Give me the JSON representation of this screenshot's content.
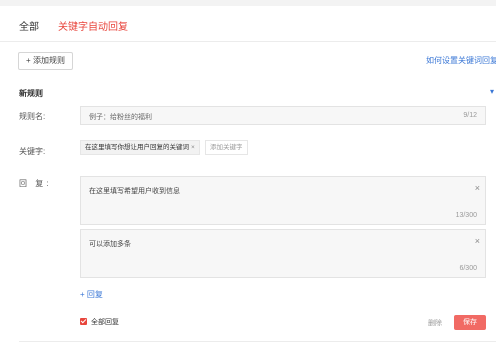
{
  "tabs": [
    {
      "label": "全部"
    },
    {
      "label": "关键字自动回复"
    }
  ],
  "toolbar": {
    "add_rule_label": "+ 添加规则",
    "help_link": "如何设置关键词回复"
  },
  "rule": {
    "section_title": "新规则",
    "name_label": "规则名:",
    "name_value": "例子：给粉丝的福利",
    "name_count": "9/12",
    "keyword_label": "关键字:",
    "keyword_tag": "在这里填写你想让用户回复的关键词",
    "keyword_tag_remove": "×",
    "keyword_add_placeholder": "添加关键字",
    "reply_label": "回 复:",
    "replies": [
      {
        "text": "在这里填写希望用户收到信息",
        "count": "13/300",
        "close": "×"
      },
      {
        "text": "可以添加多条",
        "count": "6/300",
        "close": "×"
      }
    ],
    "add_reply_label": "+ 回复",
    "reply_all_label": "全部回复",
    "delete_label": "删除",
    "save_label": "保存"
  },
  "colors": {
    "accent": "#e8453c",
    "link": "#3a77d6",
    "save_button": "#f16a64"
  }
}
